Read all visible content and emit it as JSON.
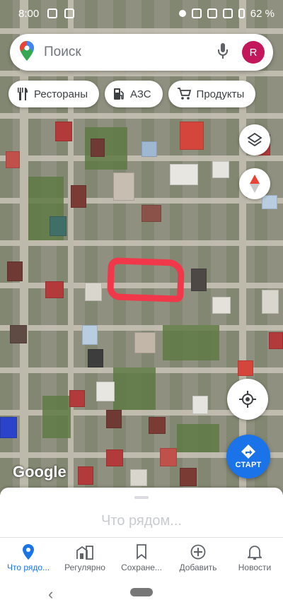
{
  "status_bar": {
    "time": "8:00",
    "battery": "62 %"
  },
  "search": {
    "placeholder": "Поиск",
    "avatar_letter": "R"
  },
  "chips": [
    {
      "label": "Рестораны",
      "icon": "restaurant-icon"
    },
    {
      "label": "АЗС",
      "icon": "gas-station-icon"
    },
    {
      "label": "Продукты",
      "icon": "shopping-cart-icon"
    }
  ],
  "map": {
    "attribution": "Google",
    "start_label": "СТАРТ"
  },
  "sheet": {
    "title": "Что рядом..."
  },
  "nav": [
    {
      "label": "Что рядо...",
      "icon": "location-pin-icon",
      "active": true
    },
    {
      "label": "Регулярно",
      "icon": "commute-icon",
      "active": false
    },
    {
      "label": "Сохране...",
      "icon": "bookmark-icon",
      "active": false
    },
    {
      "label": "Добавить",
      "icon": "add-circle-icon",
      "active": false
    },
    {
      "label": "Новости",
      "icon": "bell-icon",
      "active": false
    }
  ],
  "colors": {
    "accent": "#1a73e8",
    "avatar": "#c2185b",
    "highlight": "#f0384a"
  }
}
